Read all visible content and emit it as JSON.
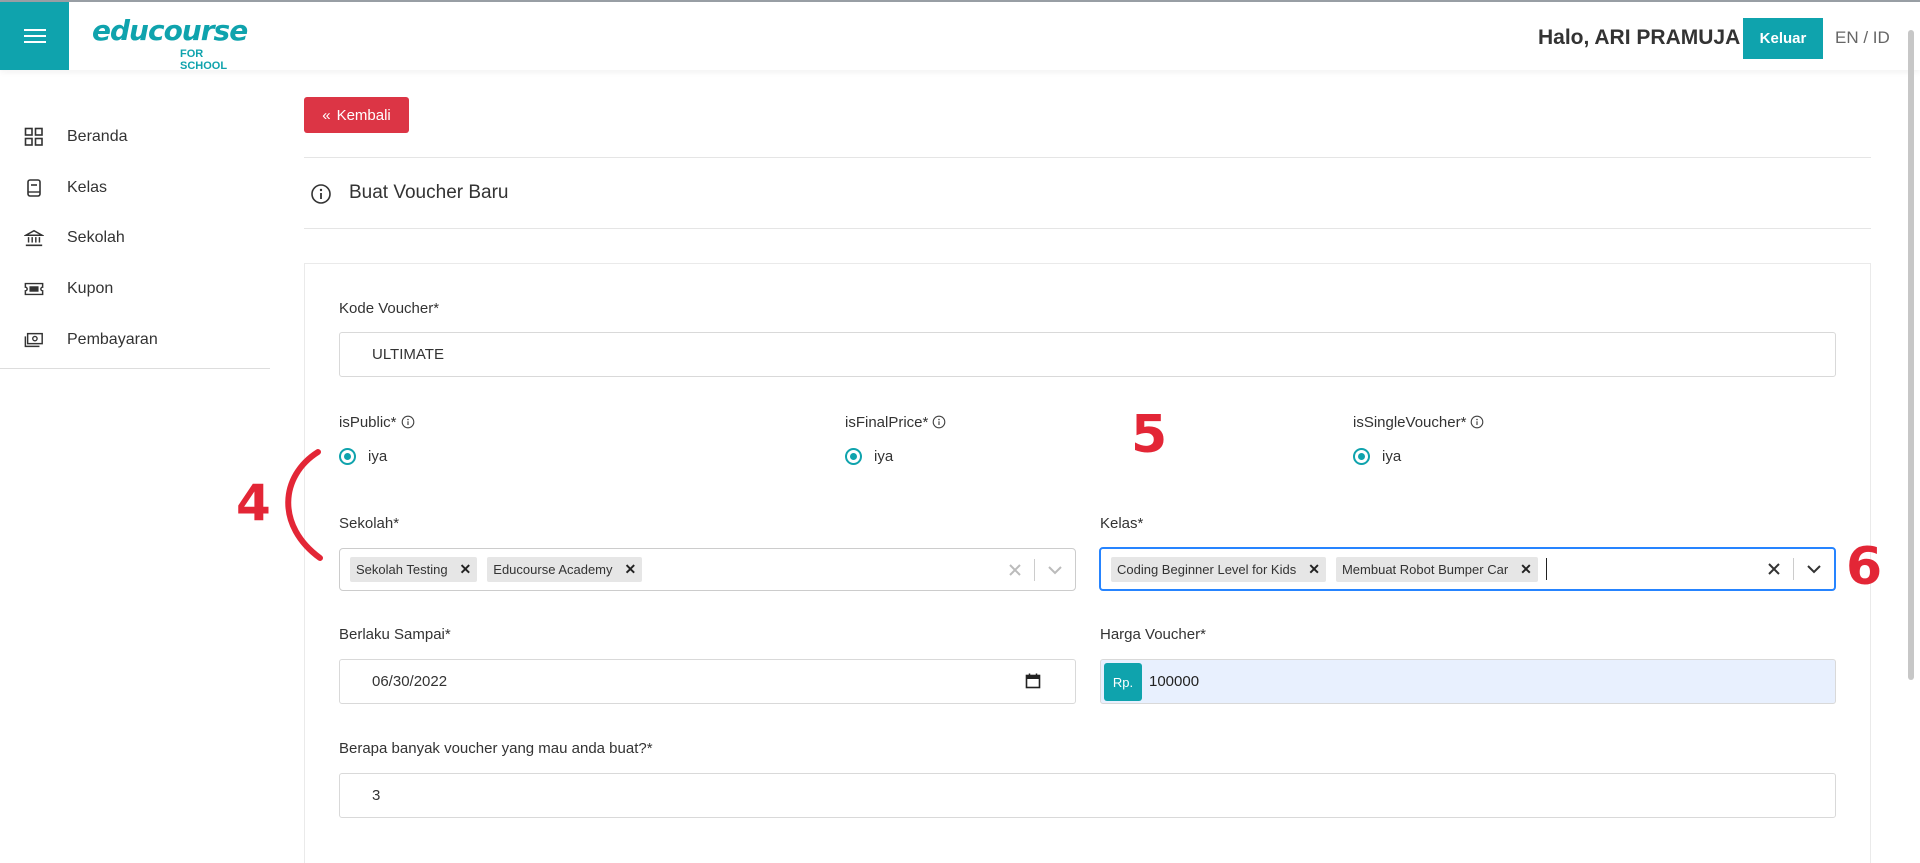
{
  "header": {
    "logo_word": "educourse",
    "logo_sub": "FOR SCHOOL",
    "greeting": "Halo, ARI PRAMUJA",
    "logout_label": "Keluar",
    "lang": "EN / ID"
  },
  "sidebar": {
    "items": [
      {
        "label": "Beranda",
        "icon": "grid-icon"
      },
      {
        "label": "Kelas",
        "icon": "book-icon"
      },
      {
        "label": "Sekolah",
        "icon": "bank-icon"
      },
      {
        "label": "Kupon",
        "icon": "ticket-icon"
      },
      {
        "label": "Pembayaran",
        "icon": "cash-icon"
      }
    ]
  },
  "main": {
    "back_label": "Kembali",
    "page_title": "Buat Voucher Baru",
    "form": {
      "kode_label": "Kode Voucher*",
      "kode_value": "ULTIMATE",
      "is_public_label": "isPublic*",
      "is_public_value": "iya",
      "is_final_price_label": "isFinalPrice*",
      "is_final_price_value": "iya",
      "is_single_label": "isSingleVoucher*",
      "is_single_value": "iya",
      "sekolah_label": "Sekolah*",
      "sekolah_tags": [
        "Sekolah Testing",
        "Educourse Academy"
      ],
      "kelas_label": "Kelas*",
      "kelas_tags": [
        "Coding Beginner Level for Kids",
        "Membuat Robot Bumper Car"
      ],
      "berlaku_label": "Berlaku Sampai*",
      "berlaku_value": "06/30/2022",
      "harga_label": "Harga Voucher*",
      "harga_prefix": "Rp.",
      "harga_value": "100000",
      "jumlah_label": "Berapa banyak voucher yang mau anda buat?*",
      "jumlah_value": "3"
    }
  },
  "annotations": {
    "four": "4",
    "five": "5",
    "six": "6"
  },
  "colors": {
    "accent": "#0fa3ad",
    "danger": "#dc3545",
    "annotation": "#e32636",
    "focus": "#2684ff"
  }
}
